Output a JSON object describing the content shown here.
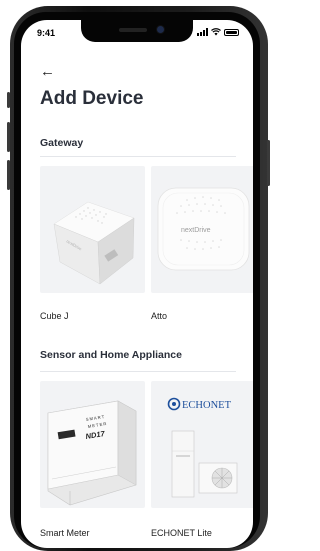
{
  "status_bar": {
    "time": "9:41"
  },
  "header": {
    "back_icon": "arrow-left-icon",
    "title": "Add Device"
  },
  "sections": [
    {
      "title": "Gateway",
      "items": [
        {
          "label": "Cube J",
          "device_text": "nextDrive"
        },
        {
          "label": "Atto",
          "device_text": "nextDrive"
        }
      ]
    },
    {
      "title": "Sensor and Home Appliance",
      "items": [
        {
          "label": "Smart Meter",
          "device_text_1": "SMART",
          "device_text_2": "METER",
          "device_text_3": "ND17"
        },
        {
          "label": "ECHONET Lite",
          "brand_text": "ECHONET"
        }
      ]
    }
  ],
  "colors": {
    "title": "#2a2f3a",
    "card_bg": "#f2f3f5",
    "echonet_blue": "#1d4f9c"
  }
}
